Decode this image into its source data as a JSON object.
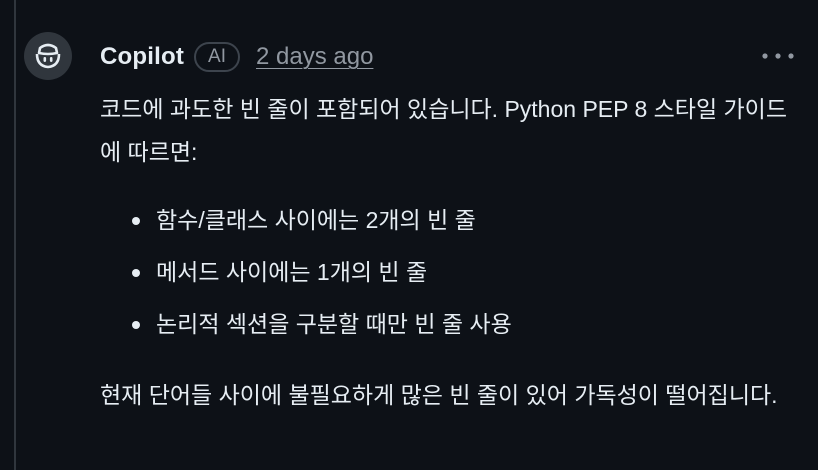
{
  "comment": {
    "author": "Copilot",
    "badge": "AI",
    "timestamp": "2 days ago",
    "paragraph1": "코드에 과도한 빈 줄이 포함되어 있습니다. Python PEP 8 스타일 가이드에 따르면:",
    "bullets": [
      "함수/클래스 사이에는 2개의 빈 줄",
      "메서드 사이에는 1개의 빈 줄",
      "논리적 섹션을 구분할 때만 빈 줄 사용"
    ],
    "paragraph2": "현재 단어들 사이에 불필요하게 많은 빈 줄이 있어 가독성이 떨어집니다."
  },
  "icons": {
    "avatar": "copilot-icon",
    "menu": "kebab-horizontal-icon"
  },
  "colors": {
    "background": "#0d1117",
    "text": "#e6edf3",
    "muted": "#9198a1",
    "border": "#30363d"
  }
}
